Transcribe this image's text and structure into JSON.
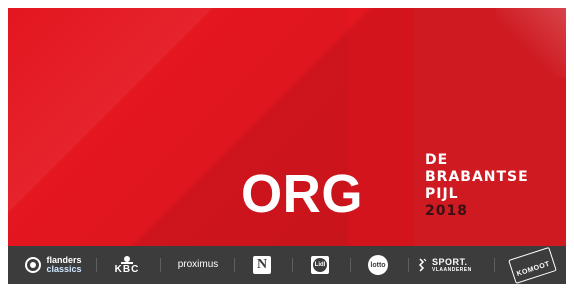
{
  "hero": {
    "org": "ORG",
    "event_lines": [
      "DE",
      "BRABANTSE",
      "PIJL"
    ],
    "year": "2018"
  },
  "sponsors": {
    "items": [
      {
        "name": "flanders classics",
        "lines": [
          "flanders",
          "classics"
        ],
        "icon": "flanders-classics-logo"
      },
      {
        "name": "KBC",
        "text": "KBC",
        "icon": "kbc-logo"
      },
      {
        "name": "proximus",
        "text": "proximus",
        "icon": "proximus-logo"
      },
      {
        "name": "Het Nieuwsblad",
        "text": "N",
        "icon": "het-nieuwsblad-logo"
      },
      {
        "name": "Lidl",
        "text": "Lidl",
        "icon": "lidl-logo"
      },
      {
        "name": "Lotto",
        "text": "lotto",
        "icon": "lotto-logo"
      },
      {
        "name": "Sport Vlaanderen",
        "lines": [
          "SPORT.",
          "VLAANDEREN"
        ],
        "icon": "sport-vlaanderen-logo"
      },
      {
        "name": "Komoot",
        "text": "KOMOOT",
        "icon": "komoot-logo"
      }
    ]
  },
  "colors": {
    "hero_red": "#e4161f",
    "panel_red": "#cf1a22",
    "year_dark": "#3a1012",
    "sponsor_bar": "#3c3c3c",
    "text_white": "#ffffff"
  }
}
